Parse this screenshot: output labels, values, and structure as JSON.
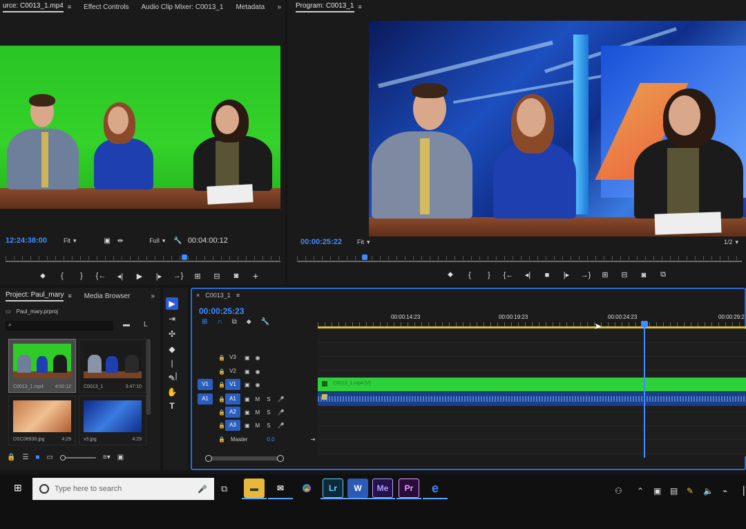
{
  "source_panel": {
    "tabs": [
      "urce: C0013_1.mp4",
      "Effect Controls",
      "Audio Clip Mixer: C0013_1",
      "Metadata"
    ],
    "overflow": "»",
    "timecode": "12:24:38:00",
    "fit": "Fit",
    "resolution": "Full",
    "duration": "00:04:00:12",
    "add_button": "+"
  },
  "program_panel": {
    "title": "Program: C0013_1",
    "timecode": "00:00:25:22",
    "fit": "Fit",
    "resolution": "1/2"
  },
  "project_panel": {
    "tabs": [
      "Project: Paul_mary",
      "Media Browser"
    ],
    "overflow": "»",
    "project_file": "Paul_mary.prproj",
    "items": [
      {
        "name": "C0013_1.mp4",
        "duration": "4:00:12"
      },
      {
        "name": "C0013_1",
        "duration": "3:47:10"
      },
      {
        "name": "DSC08938.jpg",
        "duration": "4:29"
      },
      {
        "name": "v3.jpg",
        "duration": "4:29"
      }
    ]
  },
  "timeline": {
    "sequence": "C0013_1",
    "timecode": "00:00:25:23",
    "ruler": [
      "00:00:14:23",
      "00:00:19:23",
      "00:00:24:23",
      "00:00:29:2"
    ],
    "video_tracks": [
      "V3",
      "V2",
      "V1"
    ],
    "audio_tracks": [
      "A1",
      "A2",
      "A3"
    ],
    "source_patch_video": "V1",
    "source_patch_audio": "A1",
    "track_mute": "M",
    "track_solo": "S",
    "master": "Master",
    "master_level": "0.0",
    "clip_label": "C0013_1.mp4 [V]"
  },
  "taskbar": {
    "search_placeholder": "Type here to search",
    "apps": [
      "File Explorer",
      "Mail",
      "Chrome",
      "Lr",
      "W",
      "Media Encoder",
      "Pr",
      "Edge"
    ]
  },
  "colors": {
    "accent_blue": "#3e8cff",
    "green_screen": "#2fcc27",
    "clip_green": "#2ed13b",
    "selection_blue": "#2a6ad8"
  }
}
